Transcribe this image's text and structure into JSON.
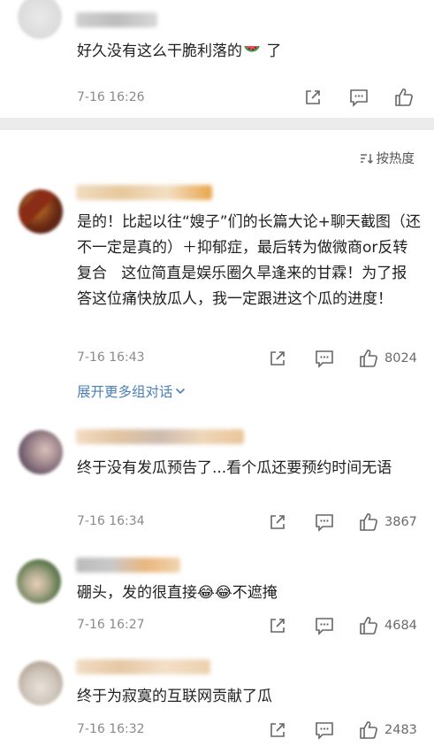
{
  "sort_label": "按热度",
  "expand_label": "展开更多组对话",
  "comments": [
    {
      "text": "好久没有这么干脆利落的",
      "text_after_emoji": " 了",
      "emoji": "watermelon",
      "time": "7-16 16:26",
      "likes": ""
    },
    {
      "text": "是的！比起以往“嫂子”们的长篇大论+聊天截图（还不一定是真的）＋抑郁症，最后转为做微商or反转复合   这位简直是娱乐圈久旱逢来的甘霖！为了报答这位痛快放瓜人，我一定跟进这个瓜的进度！",
      "time": "7-16 16:43",
      "likes": "8024"
    },
    {
      "text": "终于没有发瓜预告了...看个瓜还要预约时间无语",
      "time": "7-16 16:34",
      "likes": "3867"
    },
    {
      "text": "硼头，发的很直接😂😂不遮掩",
      "time": "7-16 16:27",
      "likes": "4684"
    },
    {
      "text": "终于为寂寞的互联网贡献了瓜",
      "time": "7-16 16:32",
      "likes": "2483"
    }
  ],
  "colors": {
    "link": "#4a7fb8",
    "divider": "#ececec",
    "muted": "#8a8a8a"
  }
}
